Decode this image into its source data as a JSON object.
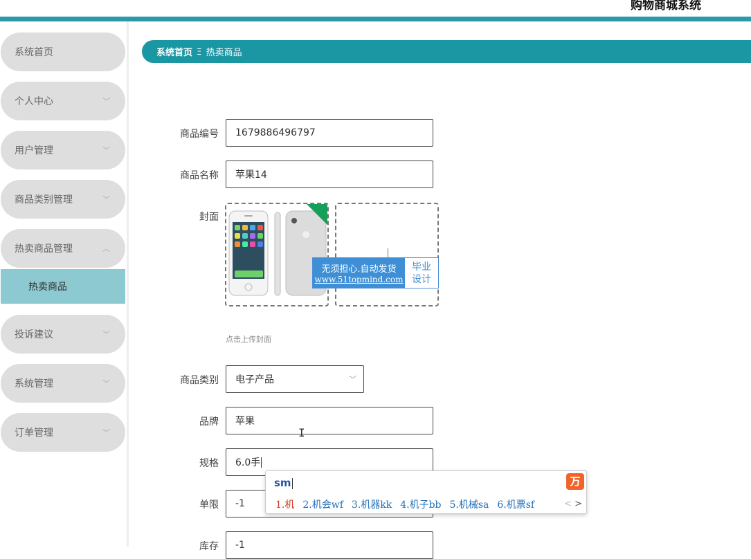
{
  "app": {
    "title": "购物商城系统"
  },
  "sidebar": {
    "items": [
      {
        "label": "系统首页",
        "chevron": ""
      },
      {
        "label": "个人中心",
        "chevron": "﹀"
      },
      {
        "label": "用户管理",
        "chevron": "﹀"
      },
      {
        "label": "商品类别管理",
        "chevron": "﹀"
      },
      {
        "label": "热卖商品管理",
        "chevron": "︿"
      },
      {
        "label": "投诉建议",
        "chevron": "﹀"
      },
      {
        "label": "系统管理",
        "chevron": "﹀"
      },
      {
        "label": "订单管理",
        "chevron": "﹀"
      }
    ],
    "submenu": {
      "label": "热卖商品"
    }
  },
  "breadcrumb": {
    "home": "系统首页",
    "separator": "Ξ",
    "current": "热卖商品"
  },
  "form": {
    "code_label": "商品编号",
    "code_value": "1679886496797",
    "name_label": "商品名称",
    "name_value": "苹果14",
    "cover_label": "封面",
    "upload_hint": "点击上传封面",
    "category_label": "商品类别",
    "category_value": "电子产品",
    "brand_label": "品牌",
    "brand_value": "苹果",
    "spec_label": "规格",
    "spec_value": "6.0手",
    "limit_label": "单限",
    "limit_value": "-1",
    "stock_label": "库存",
    "stock_value": "-1"
  },
  "watermark": {
    "line1": "无须担心.自动发货",
    "line2": "www.51topmind.com",
    "right1": "毕业",
    "right2": "设计"
  },
  "ime": {
    "input": "sm",
    "logo": "万",
    "candidates": [
      "1.机",
      "2.机会wf",
      "3.机器kk",
      "4.机子bb",
      "5.机械sa",
      "6.机票sf"
    ],
    "prev": "<",
    "next": ">"
  },
  "colors": {
    "accent": "#1b97a4",
    "sidebar_item": "#dedede",
    "submenu_active": "#8dc9d0"
  }
}
